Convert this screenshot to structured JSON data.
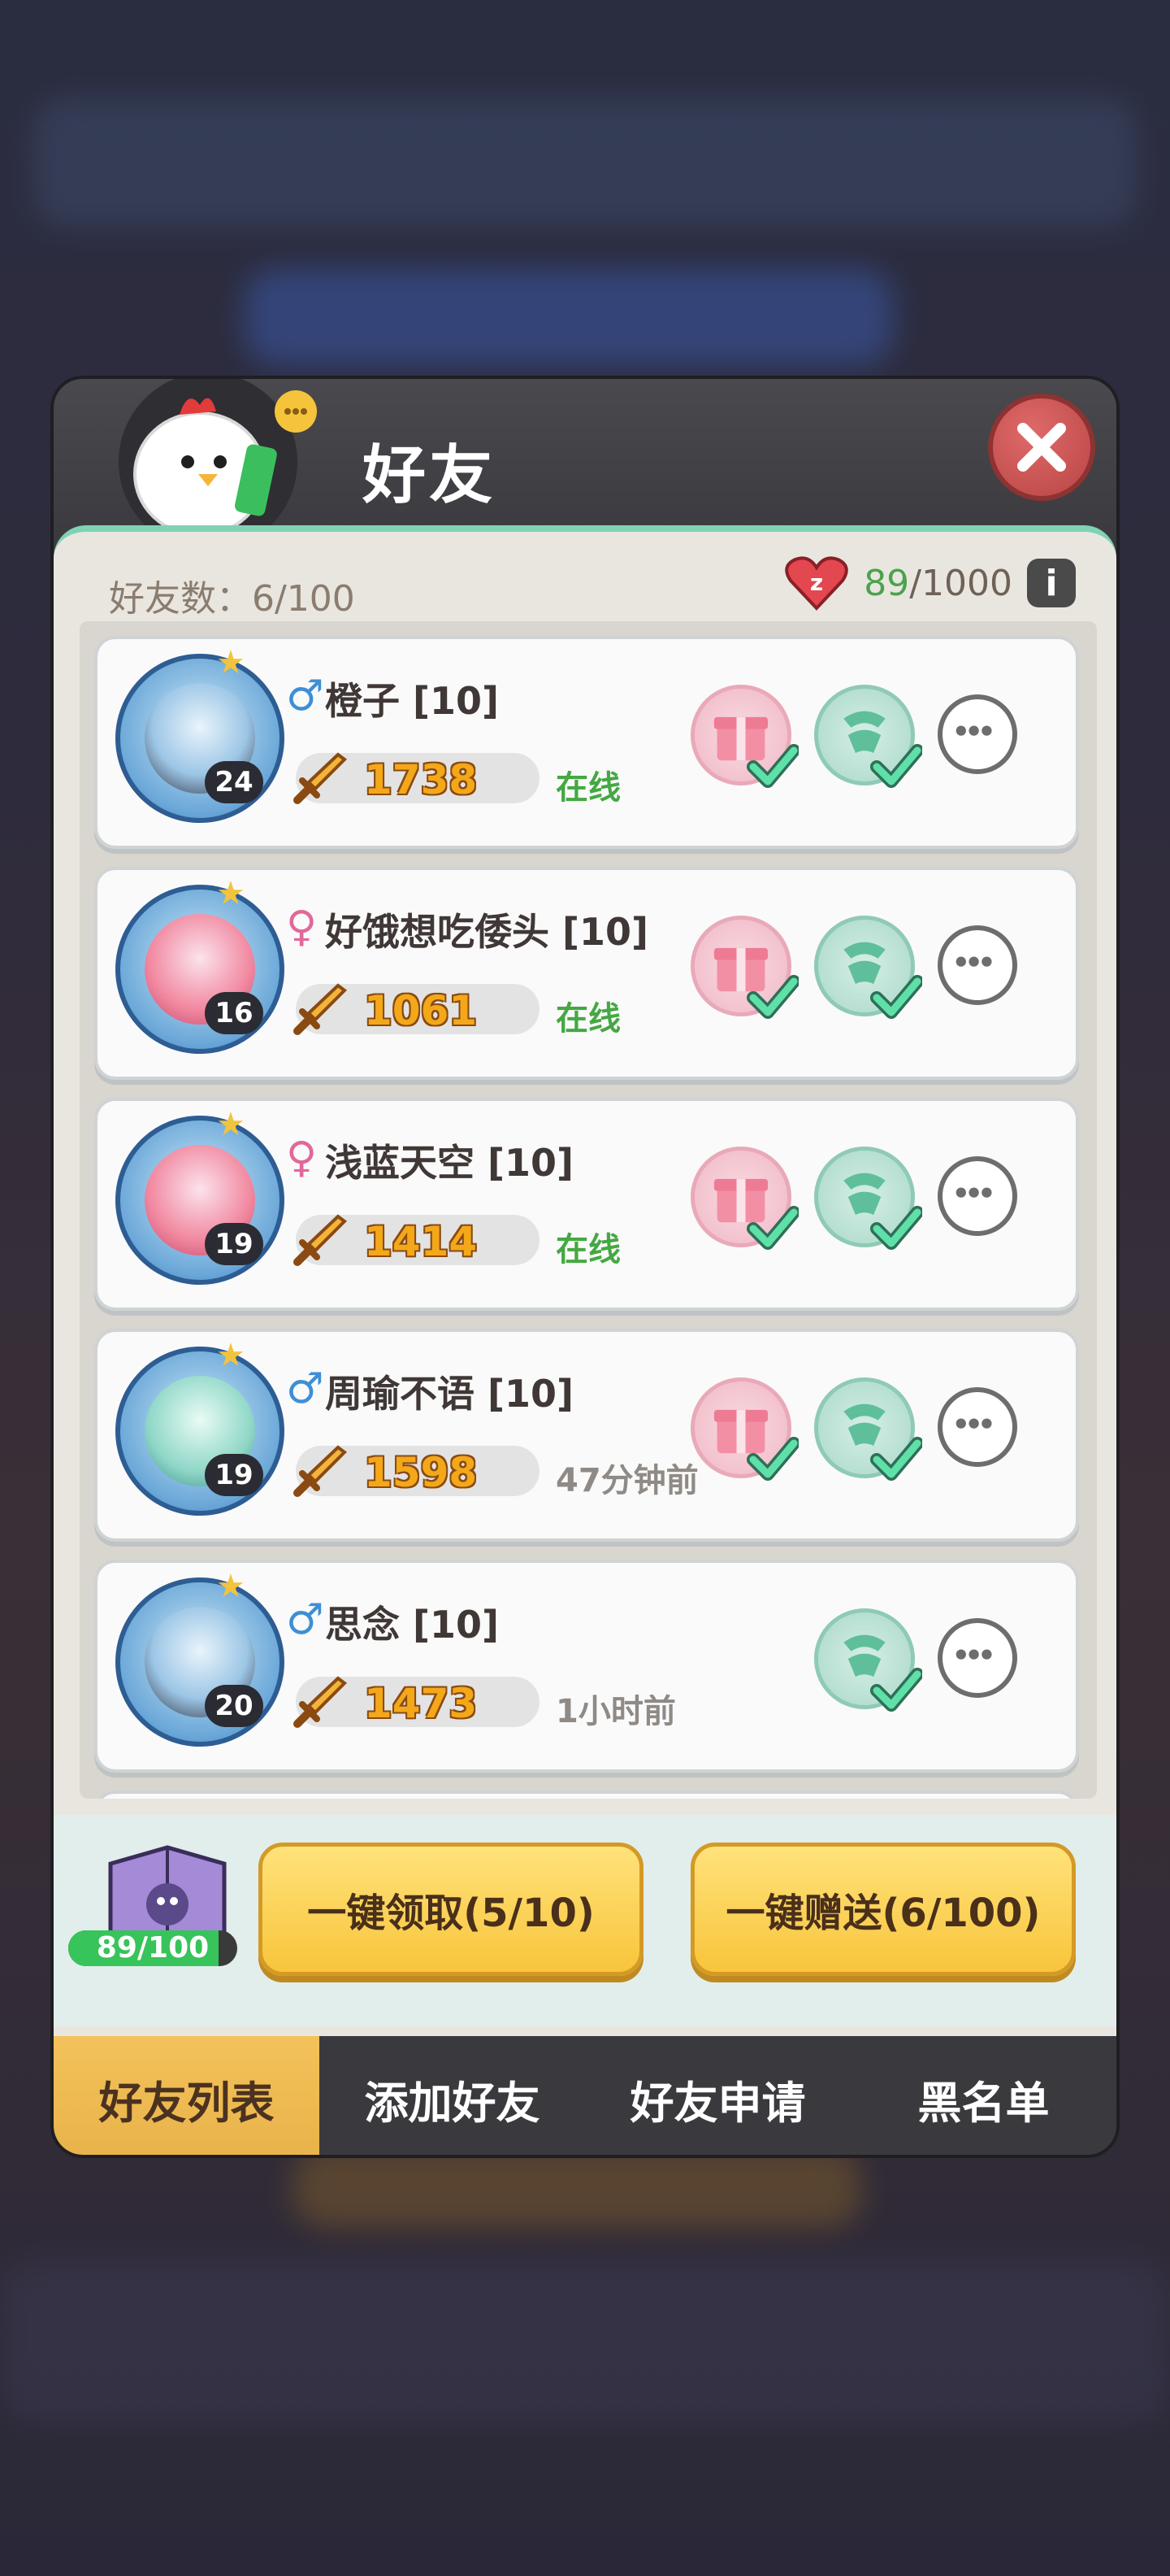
{
  "header": {
    "title": "好友"
  },
  "stats": {
    "friend_count_label": "好友数：6/100",
    "hearts_current": "89",
    "hearts_total": "/1000",
    "info_icon": "i"
  },
  "friends": [
    {
      "gender": "♂",
      "name": "橙子 [10]",
      "level": "24",
      "power": "1738",
      "status": "在线",
      "gift": true
    },
    {
      "gender": "♀",
      "name": "好饿想吃倭头 [10]",
      "level": "16",
      "power": "1061",
      "status": "在线",
      "gift": true
    },
    {
      "gender": "♀",
      "name": "浅蓝天空 [10]",
      "level": "19",
      "power": "1414",
      "status": "在线",
      "gift": true
    },
    {
      "gender": "♂",
      "name": "周瑜不语 [10]",
      "level": "19",
      "power": "1598",
      "status": "47分钟前",
      "gift": true
    },
    {
      "gender": "♂",
      "name": "思念 [10]",
      "level": "20",
      "power": "1473",
      "status": "1小时前",
      "gift": false
    }
  ],
  "bottom": {
    "ticket_count": "89/100",
    "ticket_progress": 0.89,
    "claim_all": "一键领取(5/10)",
    "send_all": "一键赠送(6/100)"
  },
  "tabs": [
    "好友列表",
    "添加好友",
    "好友申请",
    "黑名单"
  ],
  "colors": {
    "accent_green": "#7fd2b4",
    "online": "#45a843",
    "power": "#f3a81a",
    "button_yellow": "#f8c53b"
  }
}
